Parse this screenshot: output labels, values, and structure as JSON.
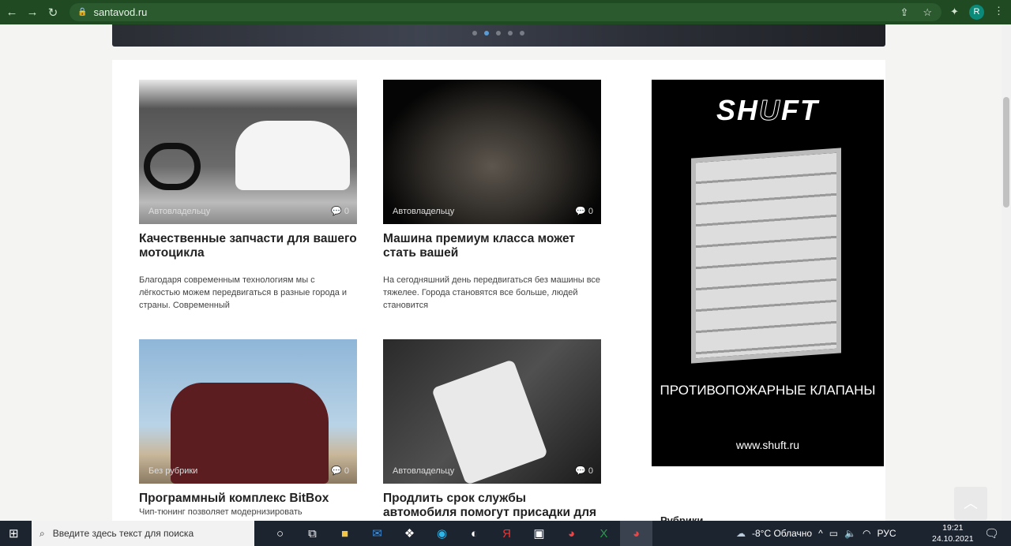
{
  "browser": {
    "url": "santavod.ru",
    "avatar": "R"
  },
  "posts": [
    {
      "category": "Автовладельцу",
      "comments": "0",
      "title": "Качественные запчасти для вашего мотоцикла",
      "excerpt": "Благодаря современным технологиям мы с лёгкостью можем передвигаться в разные города и страны. Современный"
    },
    {
      "category": "Автовладельцу",
      "comments": "0",
      "title": "Машина премиум класса может стать вашей",
      "excerpt": "На сегодняшний день передвигаться без машины все тяжелее. Города становятся все больше, людей становится"
    },
    {
      "category": "Без рубрики",
      "comments": "0",
      "title": "Программный комплекс BitBox",
      "excerpt": "Чип-тюнинг позволяет модернизировать"
    },
    {
      "category": "Автовладельцу",
      "comments": "0",
      "title": "Продлить срок службы автомобиля помогут присадки для двигателя",
      "excerpt": ""
    }
  ],
  "ad": {
    "logo": "SHUFT",
    "text": "ПРОТИВОПОЖАРНЫЕ КЛАПАНЫ",
    "url": "www.shuft.ru"
  },
  "sidebar": {
    "heading": "Рубрики"
  },
  "taskbar": {
    "search_placeholder": "Введите здесь текст для поиска",
    "weather": "-8°C  Облачно",
    "lang": "РУС",
    "time": "19:21",
    "date": "24.10.2021"
  }
}
